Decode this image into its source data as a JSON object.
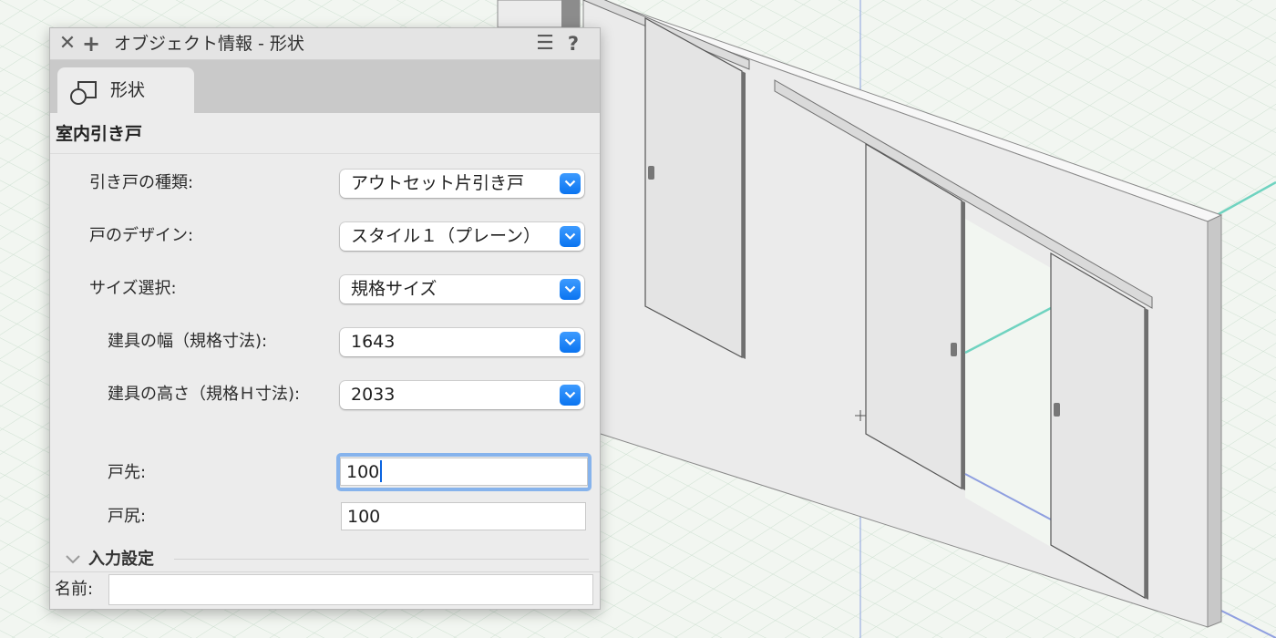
{
  "palette": {
    "title": "オブジェクト情報 - 形状",
    "close_icon": "x-icon",
    "add_icon": "plus-icon",
    "menu_icon": "hamburger-icon",
    "help_icon": "question-icon"
  },
  "tabs": [
    {
      "label": "形状",
      "icon": "shape-icon",
      "active": true
    }
  ],
  "section": {
    "title": "室内引き戸",
    "fields": [
      {
        "label": "引き戸の種類:",
        "type": "select",
        "value": "アウトセット片引き戸"
      },
      {
        "label": "戸のデザイン:",
        "type": "select",
        "value": "スタイル１（プレーン）"
      },
      {
        "label": "サイズ選択:",
        "type": "select",
        "value": "規格サイズ"
      },
      {
        "label": "建具の幅（規格寸法):",
        "type": "select",
        "value": "1643"
      },
      {
        "label": "建具の高さ（規格Ｈ寸法):",
        "type": "select",
        "value": "2033"
      },
      {
        "label": "戸先:",
        "type": "text",
        "value": "100",
        "focused": true
      },
      {
        "label": "戸尻:",
        "type": "text",
        "value": "100"
      }
    ]
  },
  "subsection": {
    "title": "入力設定",
    "icon": "chevron-down-icon",
    "expanded": true
  },
  "name_field": {
    "label": "名前:",
    "value": ""
  },
  "colors": {
    "accent": "#1a82f7",
    "focus_ring": "#86b3ec",
    "panel_bg": "#ececec",
    "tabbar_bg": "#c9c9c9",
    "grid_line": "#c7dccb",
    "axis_green": "#6fd3c0",
    "axis_blue": "#8f9fe0",
    "wall": "#ebebeb"
  }
}
